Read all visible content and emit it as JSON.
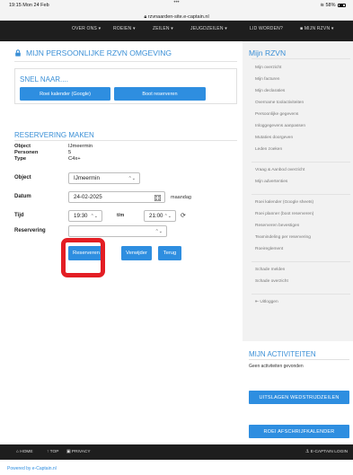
{
  "statusbar": {
    "time": "19:15  Mon 24 Feb",
    "dots": "•••",
    "battery": "58%"
  },
  "urlbar": {
    "url": "rzvnaarden-site.e-captain.nl"
  },
  "nav": {
    "items": [
      "OVER ONS ▾",
      "ROEIEN ▾",
      "ZEILEN ▾",
      "JEUGDZEILEN ▾",
      "LID WORDEN?",
      "MIJN RZVN ▾"
    ]
  },
  "main": {
    "title": "MIJN PERSOONLIJKE RZVN OMGEVING",
    "snel": {
      "title": "SNEL NAAR....",
      "buttons": [
        "Roei kalender (Google)",
        "Boot reserveren"
      ]
    },
    "reservering": {
      "title": "RESERVERING MAKEN",
      "details": [
        {
          "label": "Object",
          "value": "IJmeermin"
        },
        {
          "label": "Personen",
          "value": "5"
        },
        {
          "label": "Type",
          "value": "C4x+"
        }
      ],
      "form": {
        "object_label": "Object",
        "object_value": "IJmeermin",
        "datum_label": "Datum",
        "datum_value": "24-02-2025",
        "datum_day": "maandag",
        "tijd_label": "Tijd",
        "tijd_from": "19:30",
        "tijd_sep": "t/m",
        "tijd_to": "21:00",
        "reservering_label": "Reservering",
        "reservering_value": ""
      },
      "actions": [
        "Reserveren",
        "Verwijder",
        "Terug"
      ]
    }
  },
  "sidebar": {
    "title": "Mijn RZVN",
    "items_a": [
      "Mijn overzicht",
      "Mijn facturen",
      "Mijn declaraties",
      "Overname toolactiviteiten",
      "Persoonlijke gegevens",
      "Inloggegevens aanpassen",
      "Mutaties doorgeven",
      "Leden zoeken"
    ],
    "items_b": [
      "Vraag & Aanbod overzicht",
      "Mijn advertenties"
    ],
    "items_c": [
      "Roei kalender (Google sheets)",
      "Roei planner (boot reserveren)",
      "Reserveren bevestigen",
      "Teamindeling per reservering",
      "Roeireglement"
    ],
    "items_d": [
      "Schade melden",
      "Schade overzicht"
    ],
    "logout": "Uitloggen"
  },
  "activiteiten": {
    "title": "MIJN ACTIVITEITEN",
    "text": "Geen activiteiten gevonden",
    "buttons": [
      "UITSLAGEN WEDSTRIJDZEILEN",
      "ROEI AFSCHRIJFKALENDER"
    ]
  },
  "footer": {
    "home": "HOME",
    "top": "TOP",
    "privacy": "PRIVACY",
    "login": "E-CAPTAIN LOGIN",
    "powered": "Powered by e-Captain.nl"
  },
  "colors": {
    "accent": "#2e8ee0",
    "title_blue": "#3a8fd6",
    "highlight": "#e31e24",
    "nav_bg": "#1e1e1e"
  }
}
